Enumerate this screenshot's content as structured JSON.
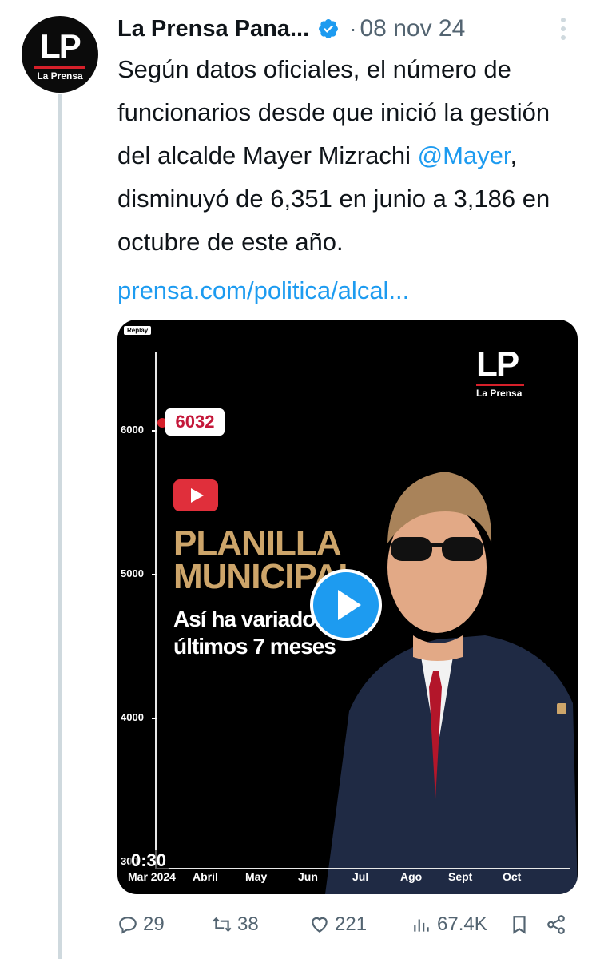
{
  "author": {
    "display_name": "La Prensa Pana...",
    "date": "08 nov 24",
    "separator": "·",
    "avatar_text": "LP",
    "avatar_subtext": "La Prensa"
  },
  "tweet": {
    "text_before_mention": "Según datos oficiales, el número de funcionarios desde que inició la gestión del alcalde Mayer Mizrachi ",
    "mention": "@Mayer",
    "text_after_mention": ", disminuyó de 6,351 en junio a 3,186 en octubre de este año.",
    "link": "prensa.com/politica/alcal..."
  },
  "video": {
    "replay_label": "Replay",
    "logo_text": "LP",
    "logo_subtext": "La Prensa",
    "callout_value": "6032",
    "title_line1": "PLANILLA",
    "title_line2": "MUNICIPAL",
    "subtitle_line1": "Así ha variado",
    "subtitle_line2": "últimos 7 meses",
    "duration": "0:30",
    "y_ticks": [
      "6000",
      "5000",
      "4000",
      "300"
    ],
    "x_ticks": [
      "Mar 2024",
      "Abril",
      "May",
      "Jun",
      "Jul",
      "Ago",
      "Sept",
      "Oct"
    ]
  },
  "actions": {
    "replies": "29",
    "reposts": "38",
    "likes": "221",
    "views": "67.4K"
  },
  "colors": {
    "accent": "#1d9bf0",
    "muted": "#536471",
    "brand_red": "#d6202a",
    "title_gold": "#cda56a"
  },
  "icons": [
    "verified-badge-icon",
    "more-icon",
    "play-icon",
    "reply-icon",
    "repost-icon",
    "like-icon",
    "views-icon",
    "bookmark-icon",
    "share-icon"
  ]
}
